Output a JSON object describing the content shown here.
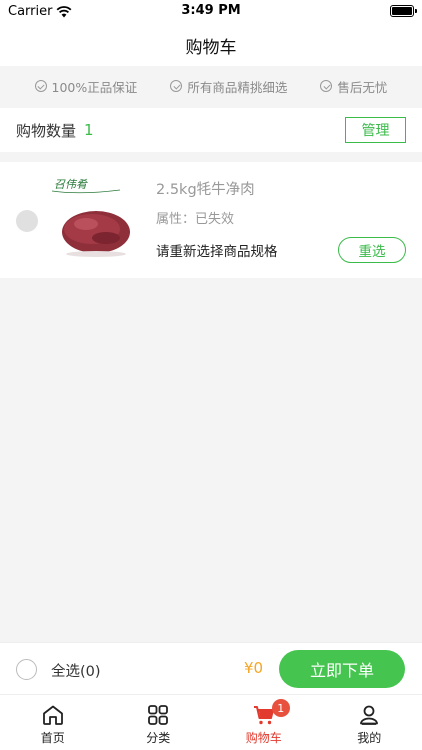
{
  "status_bar": {
    "carrier": "Carrier",
    "time": "3:49 PM"
  },
  "nav": {
    "title": "购物车"
  },
  "guarantees": [
    "100%正品保证",
    "所有商品精挑细选",
    "售后无忧"
  ],
  "cart": {
    "count_label": "购物数量",
    "count": "1",
    "manage_label": "管理",
    "items": [
      {
        "brand": "召伟肴",
        "title": "2.5kg牦牛净肉",
        "attr": "属性：已失效",
        "note": "请重新选择商品规格",
        "reselect_label": "重选"
      }
    ]
  },
  "checkout": {
    "select_all_label": "全选(0)",
    "total": "¥0",
    "order_label": "立即下单"
  },
  "tabs": [
    {
      "label": "首页",
      "icon": "home-icon"
    },
    {
      "label": "分类",
      "icon": "grid-icon"
    },
    {
      "label": "购物车",
      "icon": "cart-icon",
      "badge": "1",
      "active": true
    },
    {
      "label": "我的",
      "icon": "user-icon"
    }
  ],
  "colors": {
    "accent": "#3bbb4a",
    "price": "#f5a623",
    "active_tab": "#e23a2e",
    "badge": "#e8513e"
  }
}
